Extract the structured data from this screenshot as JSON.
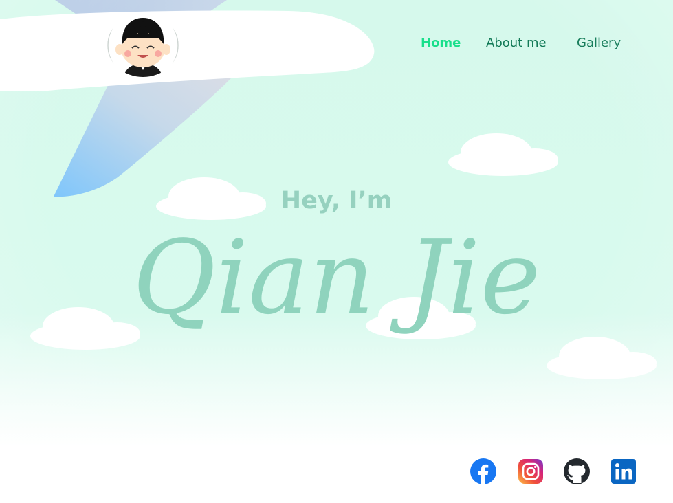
{
  "nav": {
    "items": [
      {
        "label": "Home",
        "active": true
      },
      {
        "label": "About me",
        "active": false
      },
      {
        "label": "Gallery",
        "active": false
      }
    ]
  },
  "hero": {
    "greeting": "Hey, I’m",
    "name": "Qian Jie"
  },
  "socials": [
    {
      "icon": "facebook-icon",
      "color": "#1877f2"
    },
    {
      "icon": "instagram-icon",
      "color": "#e1306c"
    },
    {
      "icon": "github-icon",
      "color": "#24292e"
    },
    {
      "icon": "linkedin-icon",
      "color": "#0a66c2"
    }
  ],
  "colors": {
    "background": "#d6f9ec",
    "nav_text": "#127a57",
    "nav_active": "#19df8b",
    "hero_text": "#8fd3bd"
  }
}
